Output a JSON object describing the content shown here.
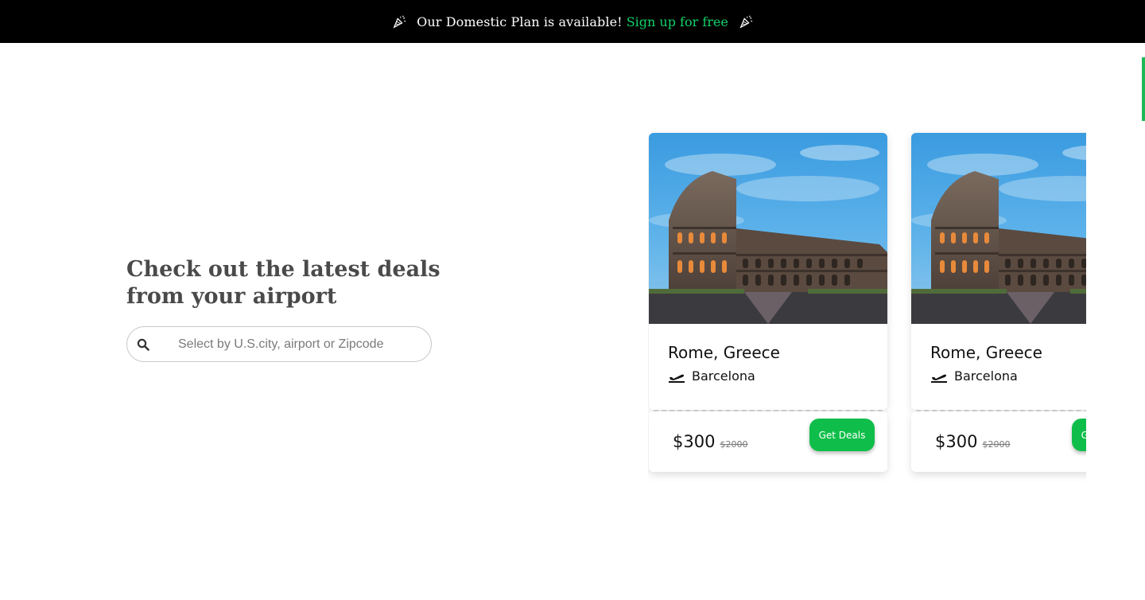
{
  "announcement": {
    "message": "Our Domestic Plan is available!",
    "link_label": "Sign up for free",
    "left_icon": "party-popper-icon",
    "right_icon": "party-popper-icon",
    "link_color": "#12d26a"
  },
  "hero": {
    "title_line1": "Check out the latest deals",
    "title_line2": "from your airport"
  },
  "search": {
    "icon": "search-icon",
    "placeholder": "Select by U.S.city, airport or Zipcode",
    "value": ""
  },
  "deals": [
    {
      "destination": "Rome, Greece",
      "origin": "Barcelona",
      "price": "$300",
      "old_price": "$2000",
      "button_label": "Get Deals",
      "image": "colosseum-photo"
    },
    {
      "destination": "Rome, Greece",
      "origin": "Barcelona",
      "price": "$300",
      "old_price": "$2000",
      "button_label": "Get Deals",
      "image": "colosseum-photo"
    }
  ],
  "colors": {
    "accent": "#0fbe4a",
    "topbar_bg": "#000000",
    "scroll_indicator": "#1db954"
  }
}
